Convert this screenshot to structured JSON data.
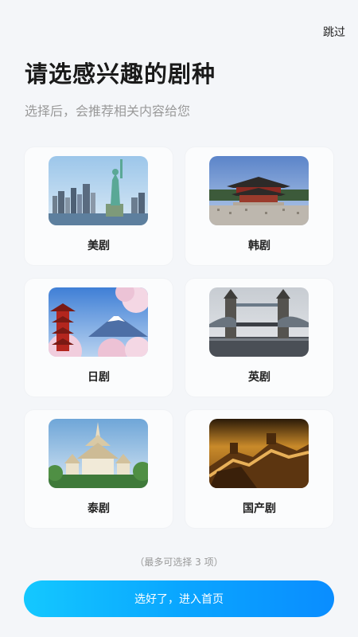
{
  "header": {
    "skip_label": "跳过"
  },
  "title": "请选感兴趣的剧种",
  "subtitle": "选择后，会推荐相关内容给您",
  "genres": [
    {
      "label": "美剧",
      "image": "statue-of-liberty-skyline"
    },
    {
      "label": "韩剧",
      "image": "korean-palace"
    },
    {
      "label": "日剧",
      "image": "pagoda-mount-fuji"
    },
    {
      "label": "英剧",
      "image": "tower-bridge"
    },
    {
      "label": "泰剧",
      "image": "thai-temple"
    },
    {
      "label": "国产剧",
      "image": "great-wall"
    }
  ],
  "hint": "（最多可选择 3 项）",
  "cta_label": "选好了，进入首页",
  "colors": {
    "accent_start": "#14c8ff",
    "accent_end": "#0a8dff",
    "background": "#f4f6f9"
  }
}
